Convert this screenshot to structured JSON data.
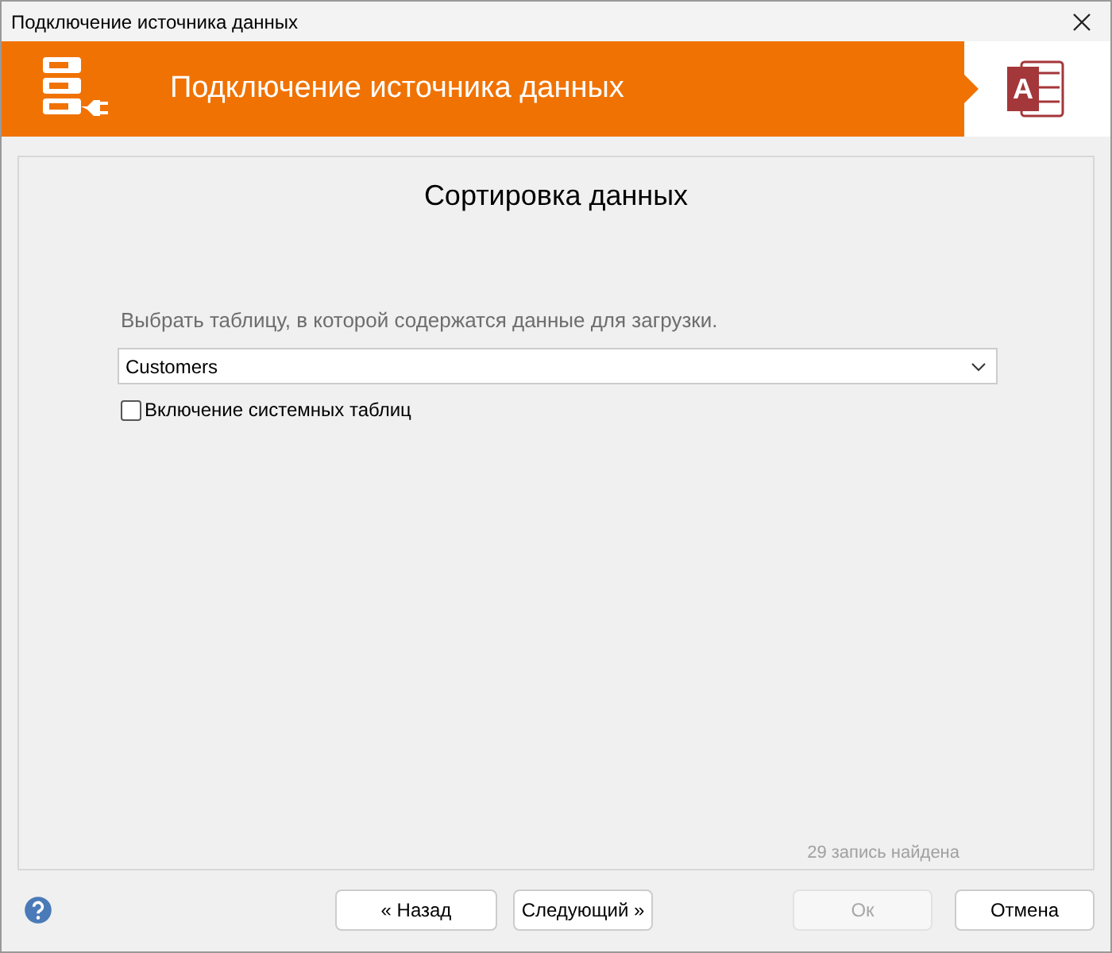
{
  "window": {
    "title": "Подключение источника данных"
  },
  "banner": {
    "title": "Подключение источника данных",
    "logo_letter": "A"
  },
  "page": {
    "heading": "Сортировка данных",
    "prompt": "Выбрать таблицу, в которой содержатся данные для загрузки.",
    "table_select": {
      "value": "Customers"
    },
    "system_tables": {
      "label": "Включение системных таблиц",
      "checked": false
    },
    "status": "29 запись найдена"
  },
  "buttons": [
    {
      "label": "« Назад",
      "disabled": false
    },
    {
      "label": "Следующий »",
      "disabled": false
    },
    {
      "label": "Ок",
      "disabled": true
    },
    {
      "label": "Отмена",
      "disabled": false
    }
  ]
}
